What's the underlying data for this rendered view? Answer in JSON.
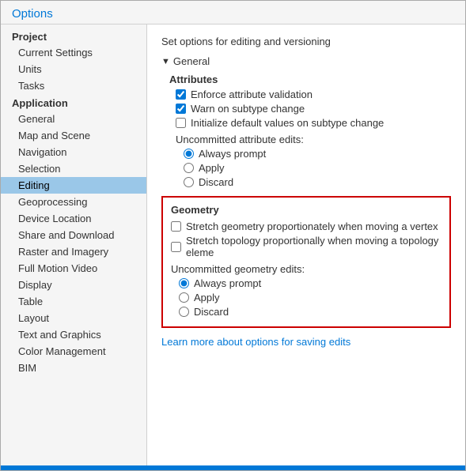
{
  "window": {
    "title": "Options"
  },
  "sidebar": {
    "groups": [
      {
        "label": "Project",
        "items": [
          "Current Settings",
          "Units",
          "Tasks"
        ]
      },
      {
        "label": "Application",
        "items": [
          "General",
          "Map and Scene",
          "Navigation",
          "Selection",
          "Editing",
          "Geoprocessing",
          "Device Location",
          "Share and Download",
          "Raster and Imagery",
          "Full Motion Video",
          "Display",
          "Table",
          "Layout",
          "Text and Graphics",
          "Color Management",
          "BIM"
        ]
      }
    ],
    "active_item": "Editing"
  },
  "main": {
    "title": "Set options for editing and versioning",
    "general_section": "General",
    "attributes_label": "Attributes",
    "checkboxes": [
      {
        "label": "Enforce attribute validation",
        "checked": true
      },
      {
        "label": "Warn on subtype change",
        "checked": true
      },
      {
        "label": "Initialize default values on subtype change",
        "checked": false
      }
    ],
    "uncommitted_attributes_label": "Uncommitted attribute edits:",
    "attribute_radios": [
      {
        "label": "Always prompt",
        "checked": true
      },
      {
        "label": "Apply",
        "checked": false
      },
      {
        "label": "Discard",
        "checked": false
      }
    ],
    "geometry_label": "Geometry",
    "geometry_checkboxes": [
      {
        "label": "Stretch geometry proportionately when moving a vertex",
        "checked": false
      },
      {
        "label": "Stretch topology proportionally when moving a topology eleme",
        "checked": false
      }
    ],
    "uncommitted_geometry_label": "Uncommitted geometry edits:",
    "geometry_radios": [
      {
        "label": "Always prompt",
        "checked": true
      },
      {
        "label": "Apply",
        "checked": false
      },
      {
        "label": "Discard",
        "checked": false
      }
    ],
    "link_text": "Learn more about options for saving edits"
  }
}
